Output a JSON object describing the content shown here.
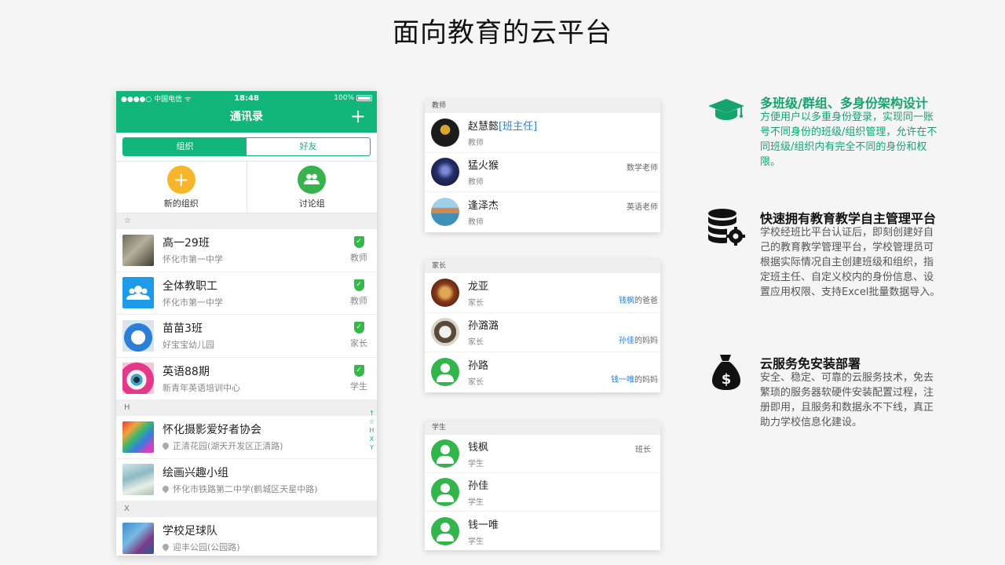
{
  "page_title": "面向教育的云平台",
  "phone": {
    "status": {
      "carrier": "●●●●○ 中国电信 ᯤ",
      "time": "18:48",
      "battery": "100%"
    },
    "nav_title": "通讯录",
    "plus": "+",
    "seg_org": "组织",
    "seg_friends": "好友",
    "quick_new_org": "新的组织",
    "quick_discussion": "讨论组",
    "section_star": "☆",
    "rows_a": [
      {
        "name": "高一29班",
        "sub": "怀化市第一中学",
        "role": "教师"
      },
      {
        "name": "全体教职工",
        "sub": "怀化市第一中学",
        "role": "教师"
      },
      {
        "name": "苗苗3班",
        "sub": "好宝宝幼儿园",
        "role": "家长"
      },
      {
        "name": "英语88期",
        "sub": "新青年英语培训中心",
        "role": "学生"
      }
    ],
    "section_h": "H",
    "rows_h": [
      {
        "name": "怀化摄影爱好者协会",
        "sub": "正清花园(湖天开发区正清路)"
      },
      {
        "name": "绘画兴趣小组",
        "sub": "怀化市铁路第二中学(鹤城区天星中路)"
      }
    ],
    "section_x": "X",
    "rows_x": [
      {
        "name": "学校足球队",
        "sub": "迎丰公园(公园路)"
      }
    ],
    "index_letters": [
      "↑",
      "☆",
      "H",
      "X",
      "Y"
    ]
  },
  "card_teacher": {
    "header": "教师",
    "rows": [
      {
        "name": "赵慧懿",
        "tag": "[班主任]",
        "sub": "教师",
        "right": ""
      },
      {
        "name": "猛火猴",
        "tag": "",
        "sub": "教师",
        "right": "数学老师"
      },
      {
        "name": "逢泽杰",
        "tag": "",
        "sub": "教师",
        "right": "英语老师"
      }
    ]
  },
  "card_parent": {
    "header": "家长",
    "rows": [
      {
        "name": "龙亚",
        "sub": "家长",
        "link": "钱枫",
        "suffix": "的爸爸"
      },
      {
        "name": "孙潞潞",
        "sub": "家长",
        "link": "孙佳",
        "suffix": "的妈妈"
      },
      {
        "name": "孙路",
        "sub": "家长",
        "link": "钱一唯",
        "suffix": "的妈妈"
      }
    ]
  },
  "card_student": {
    "header": "学生",
    "rows": [
      {
        "name": "钱枫",
        "sub": "学生",
        "right": "班长"
      },
      {
        "name": "孙佳",
        "sub": "学生",
        "right": ""
      },
      {
        "name": "钱一唯",
        "sub": "学生",
        "right": ""
      }
    ]
  },
  "features": [
    {
      "title": "多班级/群组、多身份架构设计",
      "desc": "方便用户以多重身份登录，实现同一账号不同身份的班级/组织管理，允许在不同班级/组织内有完全不同的身份和权限。",
      "icon": "graduation-cap-icon"
    },
    {
      "title": "快速拥有教育教学自主管理平台",
      "desc": "学校经班比平台认证后，即刻创建好自己的教育教学管理平台，学校管理员可根据实际情况自主创建班级和组织，指定班主任、自定义校内的身份信息、设置应用权限、支持Excel批量数据导入。",
      "icon": "database-gear-icon"
    },
    {
      "title": "云服务免安装部署",
      "desc": "安全、稳定、可靠的云服务技术，免去繁琐的服务器软硬件安装配置过程，注册即用，且服务和数据永不下线，真正助力学校信息化建设。",
      "icon": "money-bag-icon"
    }
  ],
  "colors": {
    "brand_green": "#12b57a",
    "feature_green": "#15a46e",
    "link_blue": "#2a7fd8"
  }
}
